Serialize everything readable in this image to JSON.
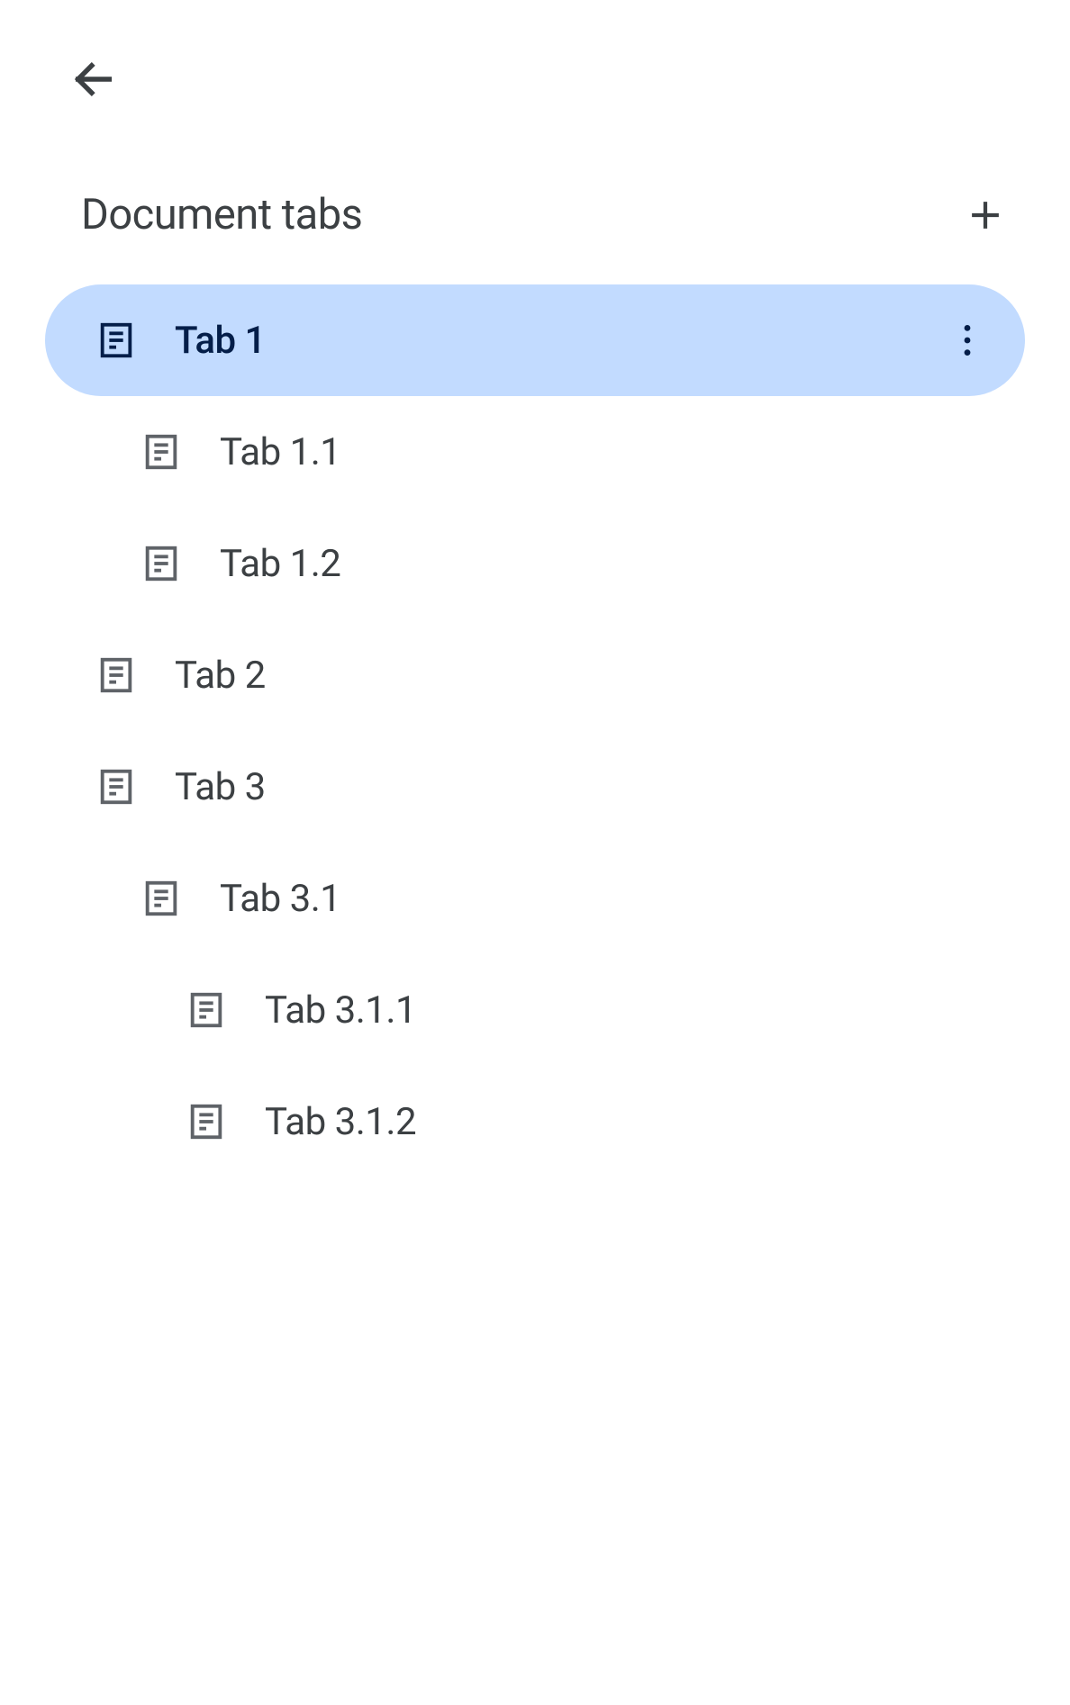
{
  "header": {
    "title": "Document tabs"
  },
  "tabs": [
    {
      "label": "Tab 1",
      "level": 0,
      "selected": true
    },
    {
      "label": "Tab 1.1",
      "level": 1,
      "selected": false
    },
    {
      "label": "Tab 1.2",
      "level": 1,
      "selected": false
    },
    {
      "label": "Tab 2",
      "level": 0,
      "selected": false
    },
    {
      "label": "Tab 3",
      "level": 0,
      "selected": false
    },
    {
      "label": "Tab 3.1",
      "level": 1,
      "selected": false
    },
    {
      "label": "Tab 3.1.1",
      "level": 2,
      "selected": false
    },
    {
      "label": "Tab 3.1.2",
      "level": 2,
      "selected": false
    }
  ],
  "colors": {
    "selected_bg": "#c2dbff",
    "selected_fg": "#041e49",
    "text": "#3c4043",
    "icon": "#5f6368"
  }
}
